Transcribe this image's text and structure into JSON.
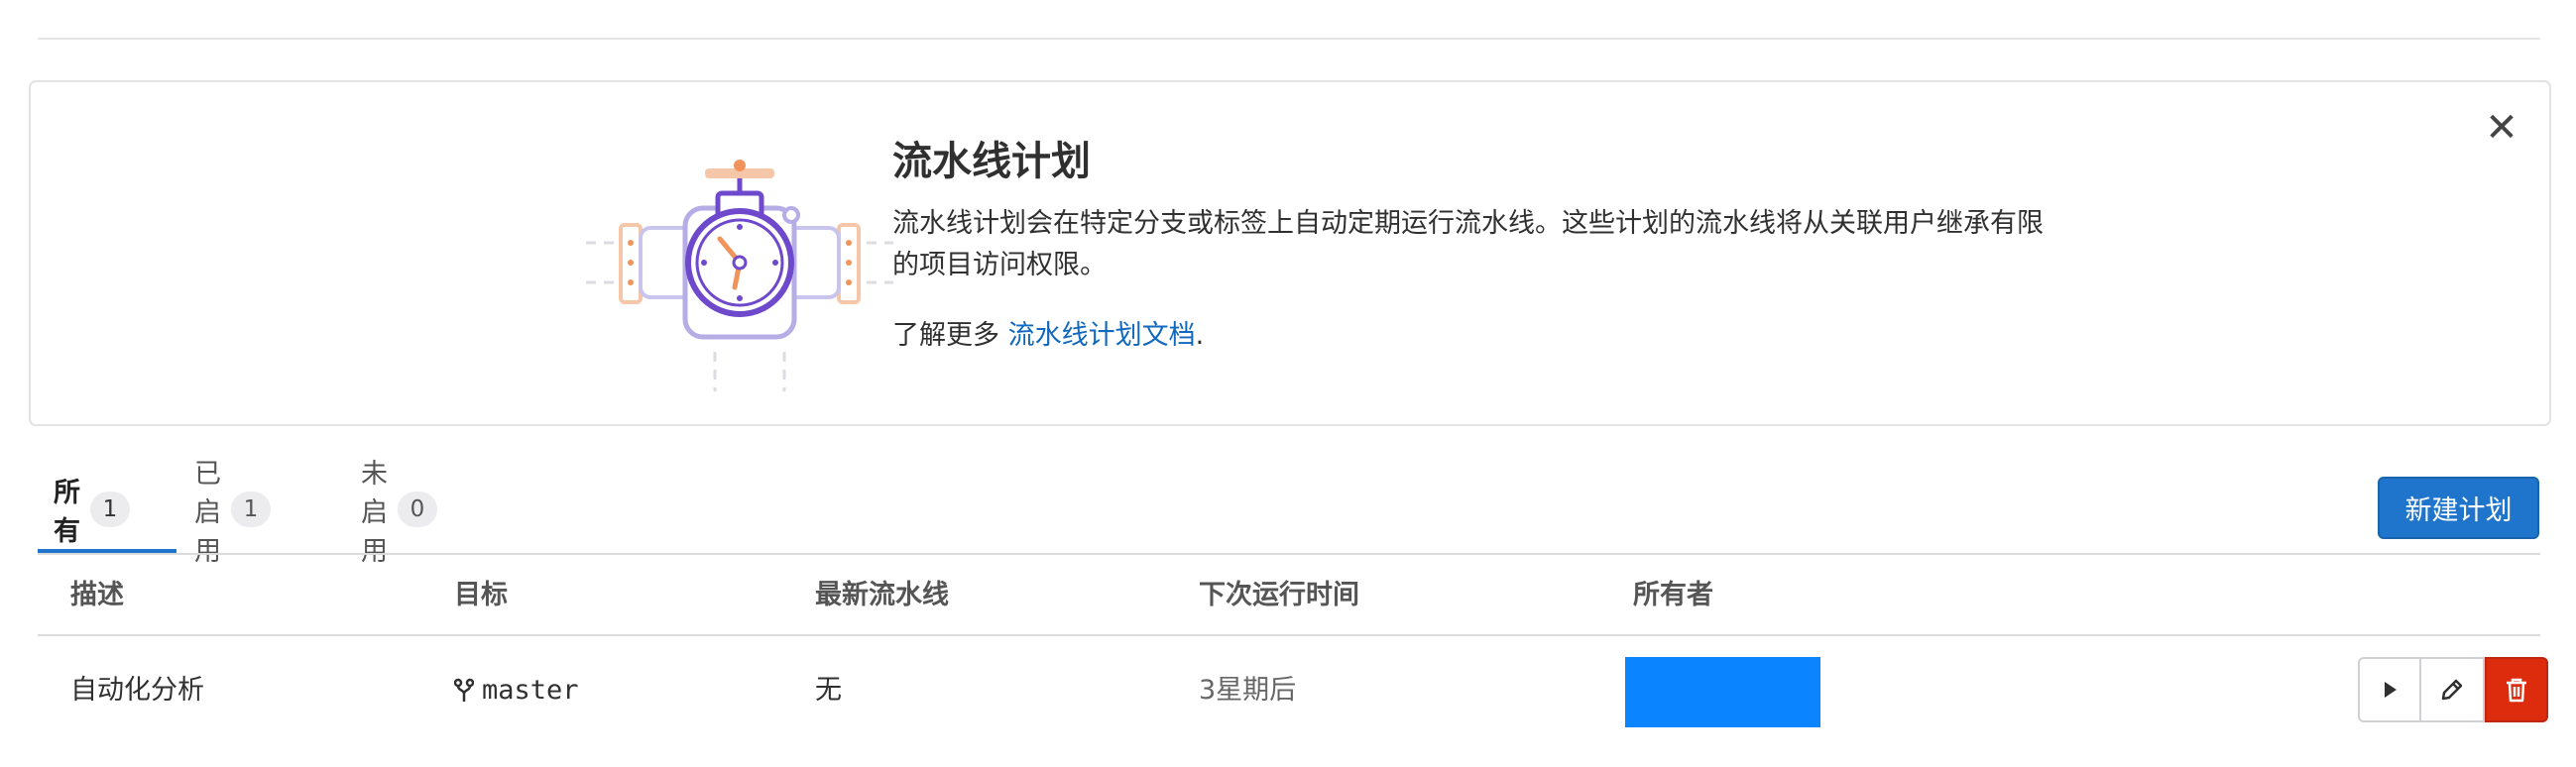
{
  "banner": {
    "title": "流水线计划",
    "description": "流水线计划会在特定分支或标签上自动定期运行流水线。这些计划的流水线将从关联用户继承有限的项目访问权限。",
    "learn_prefix": "了解更多",
    "learn_link": "流水线计划文档",
    "learn_suffix": ".",
    "close_glyph": "✕"
  },
  "tabs": [
    {
      "label": "所有",
      "count": "1",
      "active": true
    },
    {
      "label": "已启用",
      "count": "1",
      "active": false
    },
    {
      "label": "未启用",
      "count": "0",
      "active": false
    }
  ],
  "new_button_label": "新建计划",
  "table": {
    "headers": [
      "描述",
      "目标",
      "最新流水线",
      "下次运行时间",
      "所有者"
    ],
    "rows": [
      {
        "description": "自动化分析",
        "target": "master",
        "target_icon": "branch-icon",
        "last_pipeline": "无",
        "next_run": "3星期后",
        "owner_color": "#0a84ff",
        "actions": [
          "play-icon",
          "pencil-icon",
          "trash-icon"
        ]
      }
    ]
  },
  "colors": {
    "accent": "#1f75cb",
    "link": "#1068bf",
    "danger": "#dd2b0e"
  }
}
